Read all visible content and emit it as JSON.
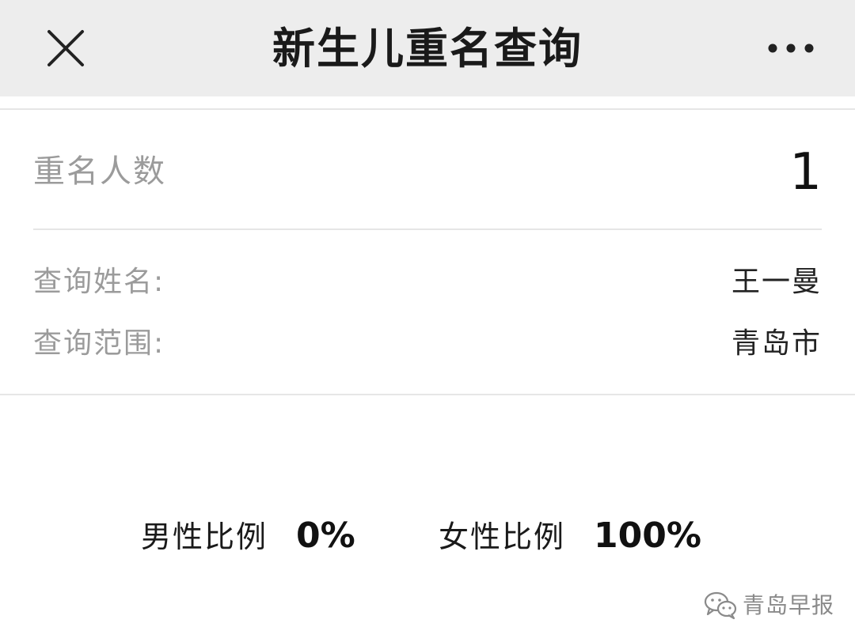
{
  "header": {
    "title": "新生儿重名查询",
    "close_icon": "close-icon",
    "more_icon": "more-dots-icon",
    "background": "#ededed"
  },
  "result": {
    "count_label": "重名人数",
    "count_value": "1",
    "name_label": "查询姓名:",
    "name_value": "王一曼",
    "scope_label": "查询范围:",
    "scope_value": "青岛市"
  },
  "ratio": {
    "male_label": "男性比例",
    "male_value": "0%",
    "female_label": "女性比例",
    "female_value": "100%"
  },
  "watermark": {
    "icon": "wechat-icon",
    "text": "青岛早报"
  }
}
